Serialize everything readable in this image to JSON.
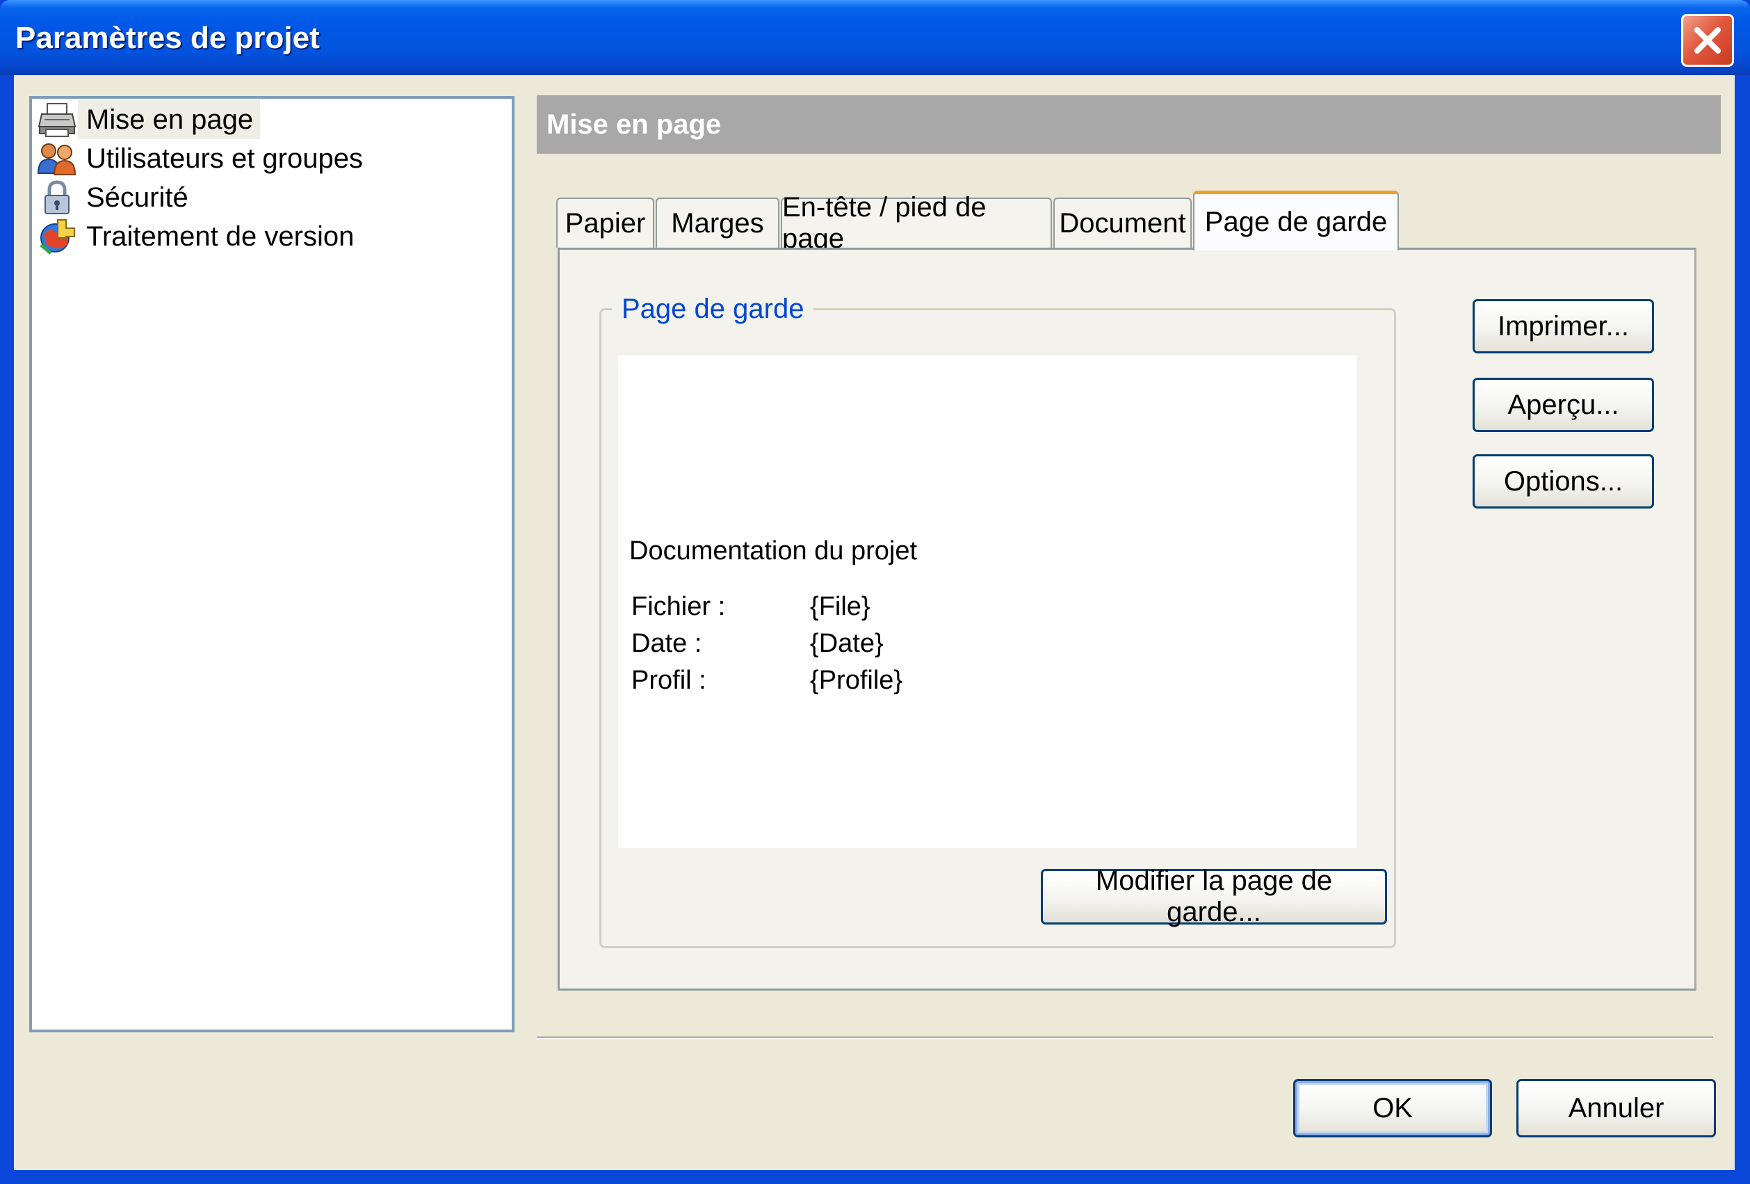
{
  "window": {
    "title": "Paramètres de projet"
  },
  "sidebar": {
    "items": [
      {
        "label": "Mise en page",
        "icon": "printer-icon",
        "selected": true
      },
      {
        "label": "Utilisateurs et groupes",
        "icon": "users-icon"
      },
      {
        "label": "Sécurité",
        "icon": "lock-icon"
      },
      {
        "label": "Traitement de version",
        "icon": "version-processing-icon"
      }
    ]
  },
  "panel": {
    "header": "Mise en page"
  },
  "tabs": [
    {
      "label": "Papier"
    },
    {
      "label": "Marges"
    },
    {
      "label": "En-tête / pied de page"
    },
    {
      "label": "Document"
    },
    {
      "label": "Page de garde",
      "active": true
    }
  ],
  "cover_page": {
    "group_label": "Page de garde",
    "preview": {
      "title": "Documentation du projet",
      "rows": [
        {
          "label": "Fichier :",
          "value": "{File}"
        },
        {
          "label": "Date :",
          "value": "{Date}"
        },
        {
          "label": "Profil :",
          "value": "{Profile}"
        }
      ]
    },
    "modify_button": "Modifier la page de garde..."
  },
  "side_buttons": {
    "print": "Imprimer...",
    "preview": "Aperçu...",
    "options": "Options..."
  },
  "footer": {
    "ok": "OK",
    "cancel": "Annuler"
  },
  "colors": {
    "title_bar": "#0058e6",
    "dialog_face": "#ece9d8",
    "active_tab_accent": "#f0a028",
    "group_label": "#0046d5",
    "close_button": "#e2583e"
  }
}
